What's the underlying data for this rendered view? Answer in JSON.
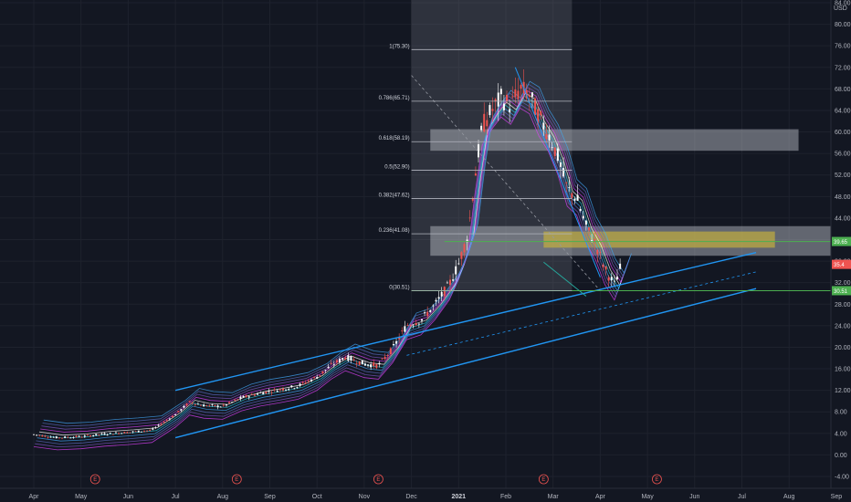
{
  "chart_data": {
    "type": "candlestick",
    "currency": "USD",
    "x_labels": [
      "Apr",
      "May",
      "Jun",
      "Jul",
      "Aug",
      "Sep",
      "Oct",
      "Nov",
      "Dec",
      "2021",
      "Feb",
      "Mar",
      "Apr",
      "May",
      "Jun",
      "Jul",
      "Aug",
      "Sep"
    ],
    "y_ticks": [
      "84.00",
      "80.00",
      "76.00",
      "72.00",
      "68.00",
      "64.00",
      "60.00",
      "56.00",
      "52.00",
      "48.00",
      "44.00",
      "40.00",
      "36.00",
      "32.00",
      "28.00",
      "24.00",
      "20.00",
      "16.00",
      "12.00",
      "8.00",
      "4.00",
      "0.00",
      "-4.00"
    ],
    "ylim": [
      -4,
      84
    ],
    "fibonacci": [
      {
        "label": "1(75.30)",
        "value": 75.3
      },
      {
        "label": "0.786(65.71)",
        "value": 65.71
      },
      {
        "label": "0.618(58.19)",
        "value": 58.19
      },
      {
        "label": "0.5(52.90)",
        "value": 52.9
      },
      {
        "label": "0.382(47.62)",
        "value": 47.62
      },
      {
        "label": "0.236(41.08)",
        "value": 41.08
      },
      {
        "label": "0(30.51)",
        "value": 30.51
      }
    ],
    "price_tags": [
      {
        "label": "39.65",
        "value": 39.65,
        "color": "#4caf50"
      },
      {
        "label": "35.4",
        "value": 35.4,
        "color": "#ef5350"
      },
      {
        "label": "30.51",
        "value": 30.51,
        "color": "#4caf50"
      }
    ],
    "earnings_markers": [
      {
        "label": "E",
        "month_index": 1.3
      },
      {
        "label": "E",
        "month_index": 4.3
      },
      {
        "label": "E",
        "month_index": 7.3
      },
      {
        "label": "E",
        "month_index": 10.8
      },
      {
        "label": "E",
        "month_index": 13.2
      }
    ],
    "channel_levels": {
      "upper_start": [
        3.0,
        12.0
      ],
      "upper_end": [
        15.3,
        37.6
      ],
      "lower_start": [
        3.0,
        3.2
      ],
      "lower_end": [
        15.3,
        30.9
      ]
    },
    "series": [
      {
        "name": "price",
        "points": [
          [
            0,
            3.8
          ],
          [
            0.5,
            3.2
          ],
          [
            1,
            3.4
          ],
          [
            1.5,
            3.9
          ],
          [
            2,
            4.2
          ],
          [
            2.5,
            4.6
          ],
          [
            3,
            7.5
          ],
          [
            3.3,
            9.8
          ],
          [
            3.6,
            9.2
          ],
          [
            4,
            9.0
          ],
          [
            4.4,
            10.6
          ],
          [
            4.8,
            11.5
          ],
          [
            5.2,
            12.1
          ],
          [
            5.6,
            12.8
          ],
          [
            6,
            14.5
          ],
          [
            6.3,
            16.6
          ],
          [
            6.6,
            18.2
          ],
          [
            7,
            16.9
          ],
          [
            7.3,
            16.6
          ],
          [
            7.6,
            19.7
          ],
          [
            7.9,
            24.1
          ],
          [
            8.2,
            25.0
          ],
          [
            8.5,
            27.9
          ],
          [
            8.8,
            31.6
          ],
          [
            9.0,
            35.5
          ],
          [
            9.2,
            41.0
          ],
          [
            9.35,
            52.0
          ],
          [
            9.5,
            61.0
          ],
          [
            9.7,
            64.0
          ],
          [
            9.9,
            66.3
          ],
          [
            10.1,
            64.9
          ],
          [
            10.3,
            68.0
          ],
          [
            10.5,
            66.9
          ],
          [
            10.7,
            62.7
          ],
          [
            10.9,
            59.8
          ],
          [
            11.1,
            55.4
          ],
          [
            11.3,
            49.4
          ],
          [
            11.5,
            47.7
          ],
          [
            11.7,
            42.4
          ],
          [
            11.9,
            39.2
          ],
          [
            12.1,
            34.5
          ],
          [
            12.3,
            31.6
          ],
          [
            12.45,
            35.4
          ]
        ]
      }
    ]
  }
}
